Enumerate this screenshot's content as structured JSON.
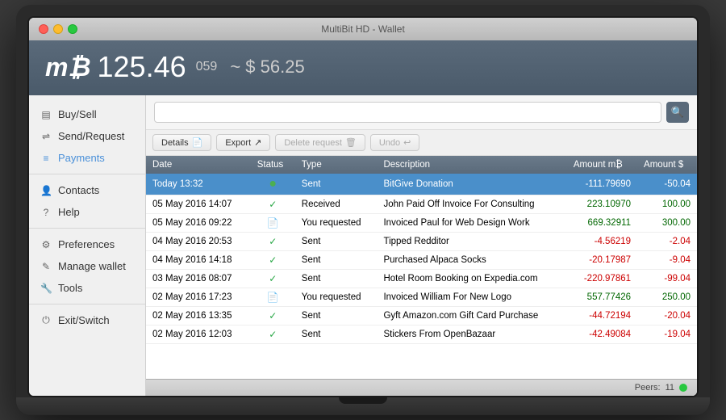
{
  "window": {
    "title": "MultiBit HD - Wallet"
  },
  "header": {
    "btc_symbol": "m₿",
    "balance_main": "125.46",
    "balance_sub": "059",
    "separator": "~",
    "balance_usd": "$ 56.25"
  },
  "sidebar": {
    "items": [
      {
        "id": "buy-sell",
        "label": "Buy/Sell",
        "icon": "▤"
      },
      {
        "id": "send-request",
        "label": "Send/Request",
        "icon": "⇌"
      },
      {
        "id": "payments",
        "label": "Payments",
        "icon": "≡",
        "active": true
      }
    ],
    "divider1": true,
    "items2": [
      {
        "id": "contacts",
        "label": "Contacts",
        "icon": "👤"
      },
      {
        "id": "help",
        "label": "Help",
        "icon": "?"
      }
    ],
    "divider2": true,
    "items3": [
      {
        "id": "preferences",
        "label": "Preferences",
        "icon": "⚙"
      },
      {
        "id": "manage-wallet",
        "label": "Manage wallet",
        "icon": "✎"
      },
      {
        "id": "tools",
        "label": "Tools",
        "icon": "🔧"
      }
    ],
    "divider3": true,
    "items4": [
      {
        "id": "exit-switch",
        "label": "Exit/Switch",
        "icon": "⏻"
      }
    ]
  },
  "toolbar": {
    "details_label": "Details",
    "export_label": "Export",
    "delete_label": "Delete request",
    "undo_label": "Undo"
  },
  "search": {
    "placeholder": "",
    "button_icon": "🔍"
  },
  "table": {
    "columns": [
      "Date",
      "Status",
      "Type",
      "Description",
      "Amount m₿",
      "Amount $"
    ],
    "rows": [
      {
        "date": "Today 13:32",
        "status": "sent_green",
        "type": "Sent",
        "description": "BitGive Donation",
        "amount_btc": "-111.79690",
        "amount_usd": "-50.04",
        "selected": true
      },
      {
        "date": "05 May 2016 14:07",
        "status": "received",
        "type": "Received",
        "description": "John Paid Off Invoice For Consulting",
        "amount_btc": "223.10970",
        "amount_usd": "100.00",
        "selected": false
      },
      {
        "date": "05 May 2016 09:22",
        "status": "requested",
        "type": "You requested",
        "description": "Invoiced Paul for Web Design Work",
        "amount_btc": "669.32911",
        "amount_usd": "300.00",
        "selected": false
      },
      {
        "date": "04 May 2016 20:53",
        "status": "received",
        "type": "Sent",
        "description": "Tipped Redditor",
        "amount_btc": "-4.56219",
        "amount_usd": "-2.04",
        "selected": false
      },
      {
        "date": "04 May 2016 14:18",
        "status": "received",
        "type": "Sent",
        "description": "Purchased Alpaca Socks",
        "amount_btc": "-20.17987",
        "amount_usd": "-9.04",
        "selected": false
      },
      {
        "date": "03 May 2016 08:07",
        "status": "received",
        "type": "Sent",
        "description": "Hotel Room Booking on Expedia.com",
        "amount_btc": "-220.97861",
        "amount_usd": "-99.04",
        "selected": false
      },
      {
        "date": "02 May 2016 17:23",
        "status": "requested",
        "type": "You requested",
        "description": "Invoiced William For New Logo",
        "amount_btc": "557.77426",
        "amount_usd": "250.00",
        "selected": false
      },
      {
        "date": "02 May 2016 13:35",
        "status": "received",
        "type": "Sent",
        "description": "Gyft Amazon.com Gift Card Purchase",
        "amount_btc": "-44.72194",
        "amount_usd": "-20.04",
        "selected": false
      },
      {
        "date": "02 May 2016 12:03",
        "status": "received",
        "type": "Sent",
        "description": "Stickers From OpenBazaar",
        "amount_btc": "-42.49084",
        "amount_usd": "-19.04",
        "selected": false
      }
    ]
  },
  "status_bar": {
    "peers_label": "Peers:",
    "peers_count": "11"
  }
}
